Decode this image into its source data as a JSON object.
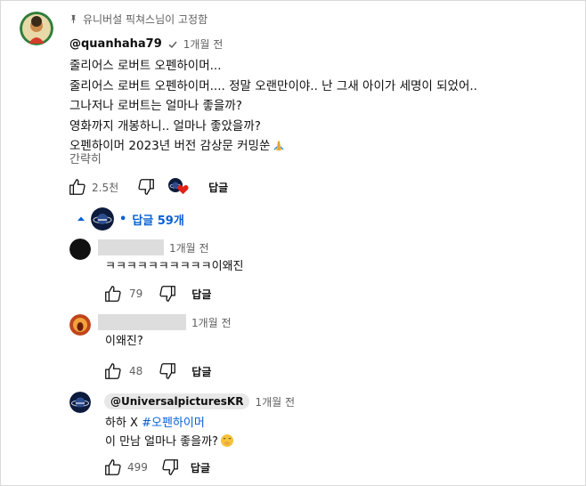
{
  "pinned": {
    "text": "유니버설 픽쳐스님이 고정함",
    "icon": "pin-icon"
  },
  "comment": {
    "author": "@quanhaha79",
    "time": "1개월 전",
    "lines": [
      "줄리어스 로버트 오펜하이머...",
      "줄리어스 로버트 오펜하이머.... 정말 오랜만이야.. 난 그새 아이가 세명이 되었어..",
      "그나저나 로버트는 얼마나 좋을까?",
      "영화까지 개봉하니.. 얼마나 좋았을까?",
      "오펜하이머 2023년 버전 감상문 커밍쑨"
    ],
    "collapse_label": "간략히",
    "likes": "2.5천",
    "reply_label": "답글"
  },
  "replies_toggle": {
    "label": "답글 59개",
    "bullet": "•"
  },
  "replies": [
    {
      "time": "1개월 전",
      "text": "ㅋㅋㅋㅋㅋㅋㅋㅋㅋㅋ이왜진",
      "likes": "79",
      "reply_label": "답글"
    },
    {
      "time": "1개월 전",
      "text": "이왜진?",
      "likes": "48",
      "reply_label": "답글"
    },
    {
      "author": "@UniversalpicturesKR",
      "time": "1개월 전",
      "line1_prefix": "하하 X ",
      "line1_hashtag": "#오펜하이머",
      "line2": "이 만남 얼마나 좋을까?",
      "likes": "499",
      "reply_label": "답글"
    }
  ],
  "colors": {
    "link": "#065fd4",
    "secondary": "#606060",
    "text": "#0f0f0f",
    "heart": "#e62117"
  }
}
